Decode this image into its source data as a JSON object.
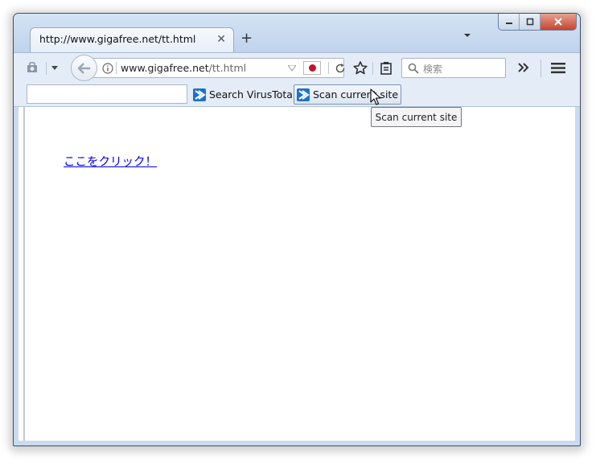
{
  "window": {
    "controls": {
      "minimize_icon": "minimize-icon",
      "maximize_icon": "maximize-icon",
      "close_icon": "close-icon"
    }
  },
  "tab": {
    "title": "http://www.gigafree.net/tt.html"
  },
  "navbar": {
    "url_host": "www.gigafree.net",
    "url_path": "/tt.html",
    "search_placeholder": "検索"
  },
  "virustotal": {
    "search_label": "Search VirusTotal",
    "scan_label": "Scan current site",
    "tooltip": "Scan current site"
  },
  "page": {
    "link_text": "ここをクリック！"
  },
  "colors": {
    "link": "#0000ee",
    "window_frame": "#c9daf1",
    "vt_blue": "#1a73c8",
    "flag_red": "#c8102e"
  }
}
